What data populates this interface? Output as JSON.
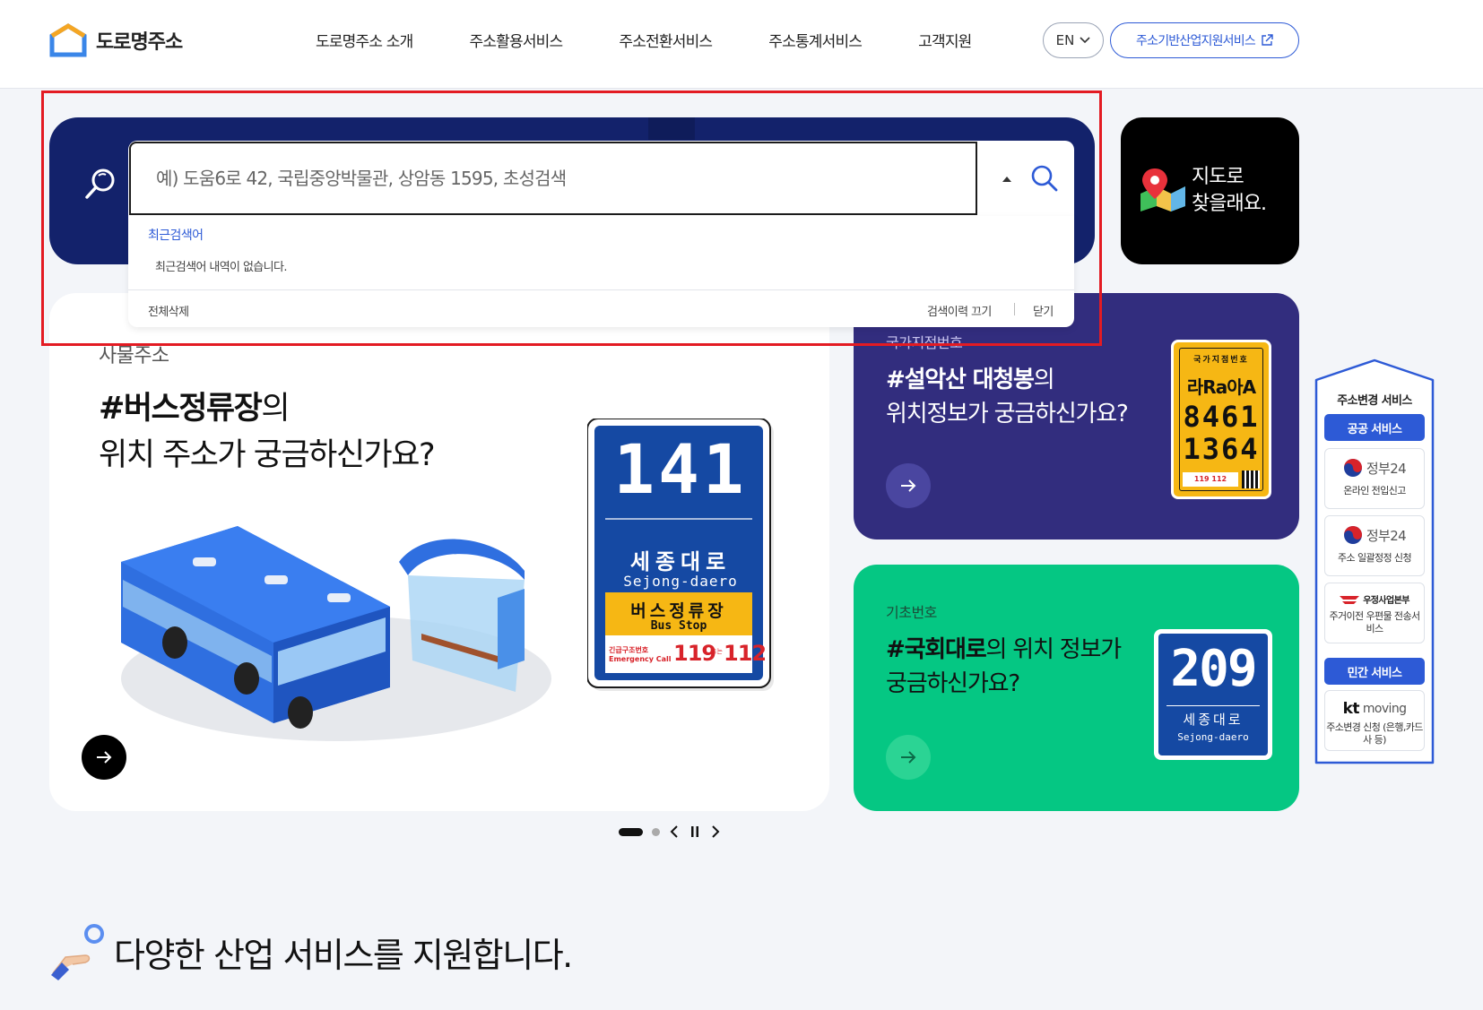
{
  "header": {
    "logo_text": "도로명주소",
    "nav": [
      "도로명주소 소개",
      "주소활용서비스",
      "주소전환서비스",
      "주소통계서비스",
      "고객지원"
    ],
    "lang": "EN",
    "ext_service": "주소기반산업지원서비스"
  },
  "search": {
    "placeholder": "예) 도움6로 42, 국립중앙박물관, 상암동 1595, 초성검색",
    "recent_title": "최근검색어",
    "recent_empty": "최근검색어 내역이 없습니다.",
    "delete_all": "전체삭제",
    "history_off": "검색이력 끄기",
    "close": "닫기"
  },
  "map_card": {
    "line1": "지도로",
    "line2": "찾을래요."
  },
  "main_card": {
    "tag": "사물주소",
    "title_bold": "#버스정류장",
    "title_rest1": "의",
    "title_line2": "위치 주소가 궁금하신가요?",
    "sign_number": "141",
    "sign_road_ko": "세종대로",
    "sign_road_en": "Sejong-daero",
    "sign_stop_ko": "버스정류장",
    "sign_stop_en": "Bus Stop",
    "sign_emergency_ko": "긴급구조번호",
    "sign_emergency_en": "Emergency Call",
    "sign_119": "119",
    "sign_or": "또는",
    "sign_112": "112"
  },
  "purple_card": {
    "tag": "국가지점번호",
    "title_bold": "#설악산 대청봉",
    "title_rest1": "의",
    "title_line2": "위치정보가 궁금하신가요?",
    "sign_header": "국가지점번호",
    "sign_letters": "라Ra아A",
    "sign_num1": "8461",
    "sign_num2": "1364",
    "sign_footer": "119 112"
  },
  "green_card": {
    "tag": "기초번호",
    "title_bold": "#국회대로",
    "title_rest1": "의 위치 정보가",
    "title_line2": "궁금하신가요?",
    "sign_number": "209",
    "sign_road_ko": "세종대로",
    "sign_road_en": "Sejong-daero"
  },
  "side_panel": {
    "title": "주소변경 서비스",
    "public_badge": "공공 서비스",
    "items": [
      {
        "logo": "정부24",
        "text": "온라인 전입신고"
      },
      {
        "logo": "정부24",
        "text": "주소 일괄정정 신청"
      },
      {
        "logo": "우정사업본부",
        "text": "주거이전 우편물 전송서비스"
      }
    ],
    "private_badge": "민간 서비스",
    "private_item": {
      "logo_kt": "kt",
      "logo_rest": "moving",
      "text": "주소변경 신청 (은행,카드사 등)"
    }
  },
  "industry": {
    "title": "다양한 산업 서비스를 지원합니다."
  },
  "colors": {
    "navy": "#13226b",
    "purple": "#322d7e",
    "green": "#05c783",
    "accent": "#2d5ad6",
    "frame": "#e31b23"
  }
}
